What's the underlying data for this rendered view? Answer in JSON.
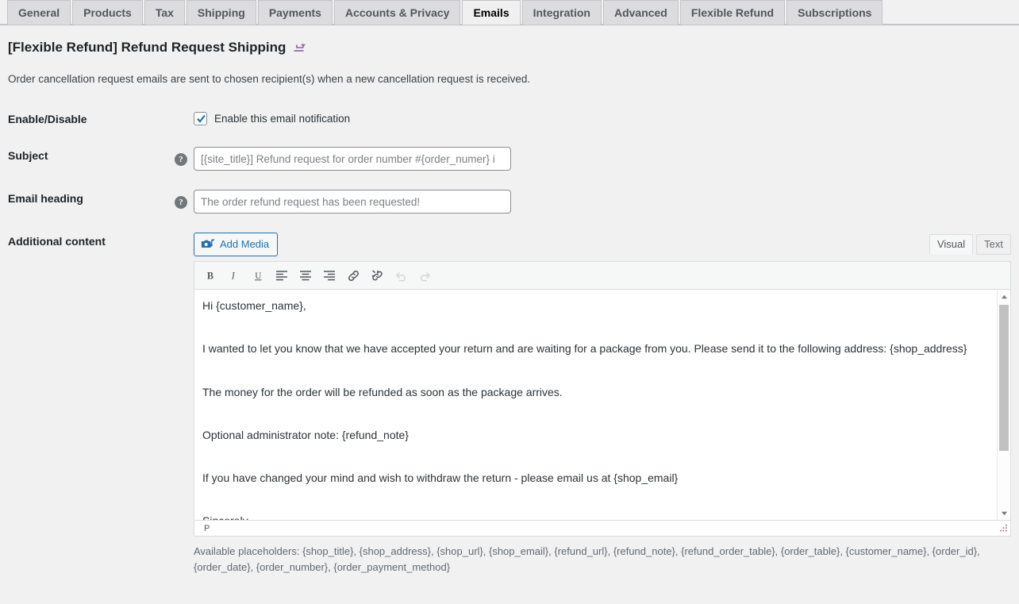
{
  "tabs": [
    {
      "label": "General",
      "active": false
    },
    {
      "label": "Products",
      "active": false
    },
    {
      "label": "Tax",
      "active": false
    },
    {
      "label": "Shipping",
      "active": false
    },
    {
      "label": "Payments",
      "active": false
    },
    {
      "label": "Accounts & Privacy",
      "active": false
    },
    {
      "label": "Emails",
      "active": true
    },
    {
      "label": "Integration",
      "active": false
    },
    {
      "label": "Advanced",
      "active": false
    },
    {
      "label": "Flexible Refund",
      "active": false
    },
    {
      "label": "Subscriptions",
      "active": false
    }
  ],
  "header": {
    "title": "[Flexible Refund] Refund Request Shipping",
    "title_icon": "return-arrow-icon",
    "title_icon_color": "#8c5e9e",
    "description": "Order cancellation request emails are sent to chosen recipient(s) when a new cancellation request is received."
  },
  "fields": {
    "enable": {
      "label": "Enable/Disable",
      "checkbox_label": "Enable this email notification",
      "checked": true,
      "check_color": "#2271b1"
    },
    "subject": {
      "label": "Subject",
      "help_icon": "help-question-icon",
      "value": "",
      "placeholder": "[{site_title}] Refund request for order number #{order_numer} i"
    },
    "email_heading": {
      "label": "Email heading",
      "help_icon": "help-question-icon",
      "value": "",
      "placeholder": "The order refund request has been requested!"
    },
    "additional_content": {
      "label": "Additional content"
    }
  },
  "editor": {
    "add_media_label": "Add Media",
    "add_media_icon": "media-camera-music-icon",
    "add_media_color": "#2271b1",
    "tabs": [
      {
        "label": "Visual",
        "active": true
      },
      {
        "label": "Text",
        "active": false
      }
    ],
    "toolbar": [
      {
        "name": "bold-icon",
        "title": "Bold",
        "disabled": false
      },
      {
        "name": "italic-icon",
        "title": "Italic",
        "disabled": false
      },
      {
        "name": "underline-icon",
        "title": "Underline",
        "disabled": false
      },
      {
        "name": "align-left-icon",
        "title": "Align left",
        "disabled": false
      },
      {
        "name": "align-center-icon",
        "title": "Align center",
        "disabled": false
      },
      {
        "name": "align-right-icon",
        "title": "Align right",
        "disabled": false
      },
      {
        "name": "link-icon",
        "title": "Insert/edit link",
        "disabled": false
      },
      {
        "name": "unlink-icon",
        "title": "Remove link",
        "disabled": false
      },
      {
        "name": "undo-icon",
        "title": "Undo",
        "disabled": true
      },
      {
        "name": "redo-icon",
        "title": "Redo",
        "disabled": true
      }
    ],
    "content": [
      "Hi {customer_name},",
      "I wanted to let you know that we have accepted your return and are waiting for a package from you. Please send it to the following address: {shop_address}",
      "The money for the order will be refunded as soon as the package arrives.",
      "Optional administrator note: {refund_note}",
      "If you have changed your mind and wish to withdraw the return - please email us at {shop_email}",
      "Sincerely"
    ],
    "statusbar_path": "P",
    "scroll_thumb_percent": 72
  },
  "placeholders_note": "Available placeholders: {shop_title}, {shop_address}, {shop_url}, {shop_email}, {refund_url}, {refund_note}, {refund_order_table}, {order_table}, {customer_name}, {order_id}, {order_date}, {order_number}, {order_payment_method}"
}
